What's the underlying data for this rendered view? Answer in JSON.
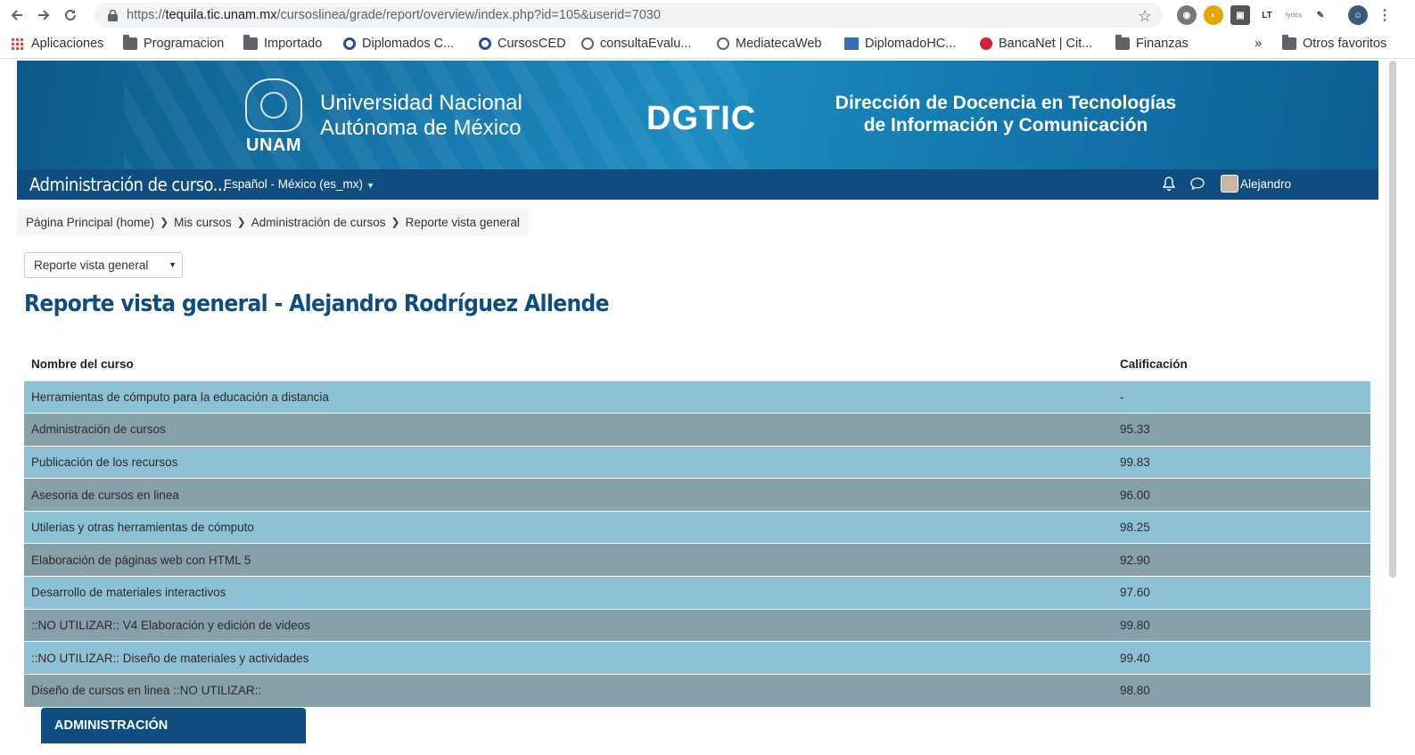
{
  "browser": {
    "url_prefix": "https://",
    "url_host": "tequila.tic.unam.mx",
    "url_path": "/cursoslinea/grade/report/overview/index.php?id=105&userid=7030",
    "bookmarks": [
      {
        "label": "Aplicaciones",
        "icon": "apps-icon"
      },
      {
        "label": "Programacion",
        "icon": "folder-icon"
      },
      {
        "label": "Importado",
        "icon": "folder-icon"
      },
      {
        "label": "Diplomados C...",
        "icon": "site-icon"
      },
      {
        "label": "CursosCED",
        "icon": "site-icon"
      },
      {
        "label": "consultaEvalu...",
        "icon": "globe-icon"
      },
      {
        "label": "MediatecaWeb",
        "icon": "globe-icon"
      },
      {
        "label": "DiplomadoHC...",
        "icon": "site-icon"
      },
      {
        "label": "BancaNet | Cit...",
        "icon": "site-icon"
      },
      {
        "label": "Finanzas",
        "icon": "folder-icon"
      }
    ],
    "more_bookmarks": "»",
    "other_favorites": "Otros favoritos"
  },
  "banner": {
    "unam_abbr": "UNAM",
    "university_line1": "Universidad Nacional",
    "university_line2": "Autónoma de México",
    "dgtic": "DGTIC",
    "direccion_line1": "Dirección de Docencia en Tecnologías",
    "direccion_line2": "de Información y Comunicación"
  },
  "navbar": {
    "site_name": "Administración de curso...",
    "language": "Español - México (es_mx)",
    "user_name": "Alejandro"
  },
  "breadcrumb": [
    "Página Principal (home)",
    "Mis cursos",
    "Administración de cursos",
    "Reporte vista general"
  ],
  "report_select": "Reporte vista general",
  "page_title": "Reporte vista general - Alejandro Rodríguez Allende",
  "table": {
    "headers": [
      "Nombre del curso",
      "Calificación"
    ],
    "rows": [
      [
        "Herramientas de cómputo para la educación a distancia",
        "-"
      ],
      [
        "Administración de cursos",
        "95.33"
      ],
      [
        "Publicación de los recursos",
        "99.83"
      ],
      [
        "Asesoria de cursos en linea",
        "96.00"
      ],
      [
        "Utilerias y otras herramientas de cómputo",
        "98.25"
      ],
      [
        "Elaboración de páginas web con HTML 5",
        "92.90"
      ],
      [
        "Desarrollo de materiales interactivos",
        "97.60"
      ],
      [
        "::NO UTILIZAR:: V4 Elaboración y edición de videos",
        "99.80"
      ],
      [
        "::NO UTILIZAR:: Diseño de materiales y actividades",
        "99.40"
      ],
      [
        "Diseño de cursos en linea ::NO UTILIZAR::",
        "98.80"
      ]
    ]
  },
  "admin_block_title": "ADMINISTRACIÓN",
  "colors": {
    "navbar": "#0f4d80",
    "row_light": "#8ec0d6",
    "row_dark": "#87a0aa",
    "title": "#0f4d80"
  }
}
